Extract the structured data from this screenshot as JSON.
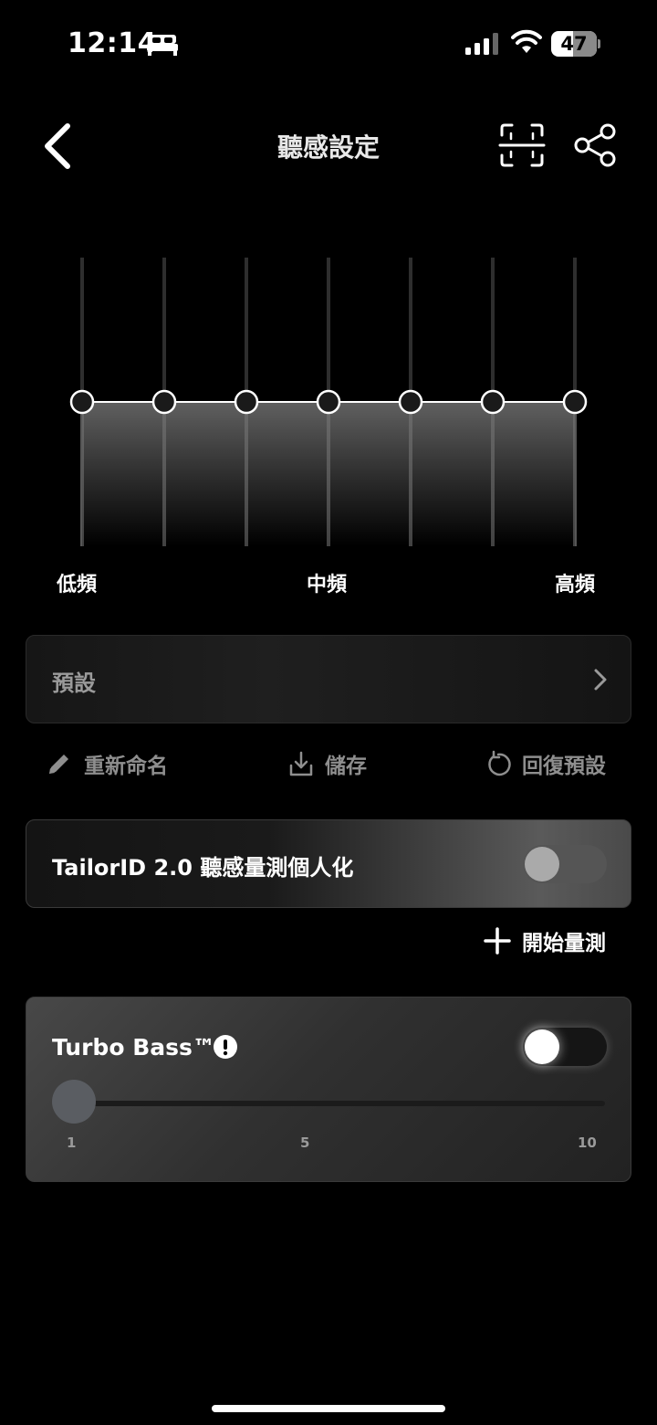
{
  "status_bar": {
    "time": "12:14",
    "battery": "47",
    "battery_level": 0.47
  },
  "nav": {
    "title": "聽感設定"
  },
  "eq": {
    "bands": [
      0,
      0,
      0,
      0,
      0,
      0,
      0
    ],
    "labels": {
      "low": "低頻",
      "mid": "中頻",
      "high": "高頻"
    }
  },
  "preset": {
    "label": "預設"
  },
  "actions": {
    "rename": "重新命名",
    "save": "儲存",
    "reset": "回復預設"
  },
  "tailor": {
    "label": "TailorID 2.0 聽感量測個人化",
    "enabled": false,
    "start_label": "開始量測"
  },
  "turbo_bass": {
    "label": "Turbo Bass™",
    "enabled": false,
    "value": 1,
    "min": 1,
    "max": 10,
    "ticks": [
      "1",
      "5",
      "10"
    ]
  }
}
